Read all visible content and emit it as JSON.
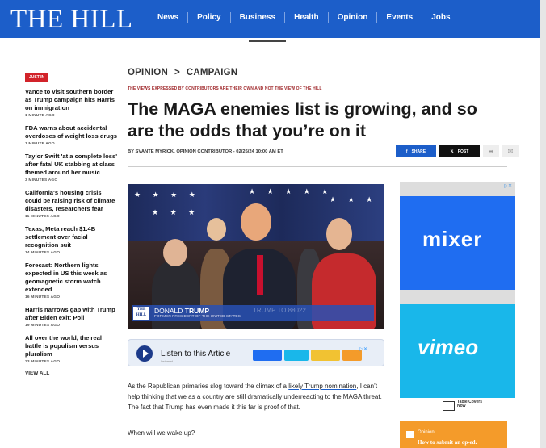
{
  "header": {
    "logo": "THE HILL",
    "nav": [
      "News",
      "Policy",
      "Business",
      "Health",
      "Opinion",
      "Events",
      "Jobs"
    ]
  },
  "rail": {
    "badge": "JUST IN",
    "items": [
      {
        "title": "Vance to visit southern border as Trump campaign hits Harris on immigration",
        "time": "1 MINUTE AGO"
      },
      {
        "title": "FDA warns about accidental overdoses of weight loss drugs",
        "time": "1 MINUTE AGO"
      },
      {
        "title": "Taylor Swift 'at a complete loss' after fatal UK stabbing at class themed around her music",
        "time": "3 MINUTES AGO"
      },
      {
        "title": "California's housing crisis could be raising risk of climate disasters, researchers fear",
        "time": "11 MINUTES AGO"
      },
      {
        "title": "Texas, Meta reach $1.4B settlement over facial recognition suit",
        "time": "14 MINUTES AGO"
      },
      {
        "title": "Forecast: Northern lights expected in US this week as geomagnetic storm watch extended",
        "time": "16 MINUTES AGO"
      },
      {
        "title": "Harris narrows gap with Trump after Biden exit: Poll",
        "time": "19 MINUTES AGO"
      },
      {
        "title": "All over the world, the real battle is populism versus pluralism",
        "time": "23 MINUTES AGO"
      }
    ],
    "view_all": "VIEW ALL"
  },
  "article": {
    "section": "OPINION",
    "separator": ">",
    "subsection": "CAMPAIGN",
    "disclaimer": "THE VIEWS EXPRESSED BY CONTRIBUTORS ARE THEIR OWN AND NOT THE VIEW OF THE HILL",
    "headline": "The MAGA enemies list is growing, and so are the odds that you’re on it",
    "byline": "BY SVANTE MYRICK, OPINION CONTRIBUTOR - 02/26/24 10:00 AM ET",
    "share_label": "SHARE",
    "post_label": "POST",
    "video": {
      "lower_third_logo": "THE HILL",
      "name_first": "DONALD ",
      "name_last": "TRUMP",
      "ghost_text": "TRUMP TO 88022",
      "subtitle": "FORMER PRESIDENT OF THE UNITED STATES"
    },
    "listen": {
      "label": "Listen to this Article",
      "sub": "Instaread"
    },
    "para1_pre": "As the Republican primaries slog toward the climax of a ",
    "para1_link": "likely Trump nomination",
    "para1_post": ", I can’t help thinking that we as a country are still dramatically underreacting to the MAGA threat. The fact that Trump has even made it this far is proof of that.",
    "para2": "When will we wake up?"
  },
  "ads": {
    "mixer": "mixer",
    "vimeo": "vimeo",
    "table_covers": "Table Covers Now",
    "oped_kicker": "Opinion",
    "oped_title": "How to submit an op-ed."
  },
  "colors": {
    "brand_blue": "#1c5ec9",
    "accent_red": "#d2232a",
    "mixer_blue": "#1f6df1",
    "vimeo_cyan": "#19b7ea",
    "oped_orange": "#f49b2a"
  }
}
